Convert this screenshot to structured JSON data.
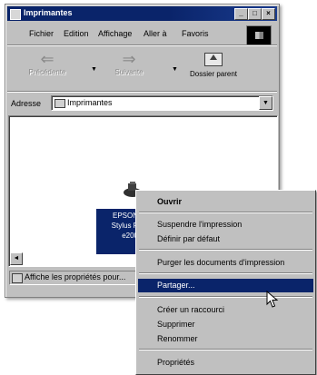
{
  "window": {
    "title": "Imprimantes",
    "controls": {
      "minimize": "_",
      "maximize": "□",
      "close": "×"
    }
  },
  "menubar": {
    "items": [
      "Fichier",
      "Edition",
      "Affichage",
      "Aller à",
      "Favoris"
    ]
  },
  "toolbar": {
    "back_label": "Précédente",
    "forward_label": "Suivante",
    "up_label": "Dossier parent"
  },
  "address": {
    "label": "Adresse",
    "value": "Imprimantes"
  },
  "printer": {
    "name_lines": [
      "EPSON",
      "Stylus P",
      "e200"
    ]
  },
  "status": {
    "text": "Affiche les propriétés pour..."
  },
  "context_menu": {
    "items": [
      {
        "label": "Ouvrir",
        "bold": true
      },
      {
        "label": "Suspendre l'impression"
      },
      {
        "label": "Définir par défaut"
      },
      {
        "label": "Purger les documents d'impression"
      },
      {
        "label": "Partager...",
        "active": true
      },
      {
        "label": "Créer un raccourci"
      },
      {
        "label": "Supprimer"
      },
      {
        "label": "Renommer"
      },
      {
        "label": "Propriétés"
      }
    ]
  },
  "colors": {
    "titlebar": "#0a246a",
    "selection": "#0a246a",
    "face": "#c0c0c0"
  }
}
